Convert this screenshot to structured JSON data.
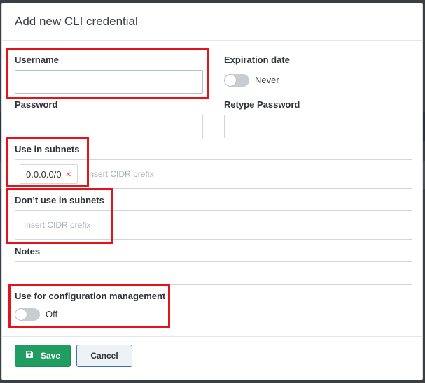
{
  "modal": {
    "title": "Add new CLI credential"
  },
  "form": {
    "username": {
      "label": "Username",
      "value": ""
    },
    "expiration": {
      "label": "Expiration date",
      "toggle_text": "Never",
      "enabled": false
    },
    "password": {
      "label": "Password",
      "value": ""
    },
    "retype_password": {
      "label": "Retype Password",
      "value": ""
    },
    "use_in_subnets": {
      "label": "Use in subnets",
      "tags": [
        "0.0.0.0/0"
      ],
      "remove_icon": "×",
      "placeholder": "Insert CIDR prefix"
    },
    "dont_use_in_subnets": {
      "label": "Don’t use in subnets",
      "placeholder": "Insert CIDR prefix"
    },
    "notes": {
      "label": "Notes",
      "value": ""
    },
    "config_management": {
      "label": "Use for configuration management",
      "toggle_text": "Off",
      "enabled": false
    }
  },
  "footer": {
    "save_label": "Save",
    "save_icon": "save-icon",
    "cancel_label": "Cancel"
  },
  "colors": {
    "primary_button": "#1f9d63",
    "highlight_box": "#e3141b",
    "remove_icon": "#d43f3a"
  }
}
